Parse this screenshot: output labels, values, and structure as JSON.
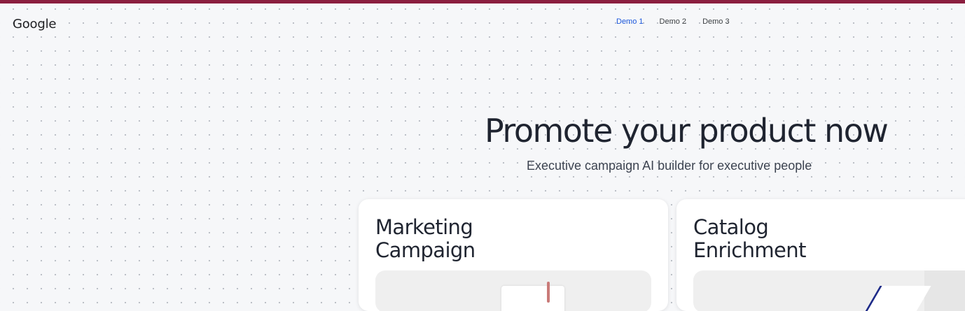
{
  "app": {
    "logo": "Google",
    "accent_color": "#8b1e3f"
  },
  "nav": {
    "items": [
      {
        "label": "Demo 1",
        "active": true
      },
      {
        "label": "Demo 2",
        "active": false
      },
      {
        "label": "Demo 3",
        "active": false
      }
    ],
    "active_color": "#1a56db"
  },
  "hero": {
    "title": "Promote your product now",
    "subtitle": "Executive campaign AI builder for executive people"
  },
  "cards": [
    {
      "title_line1": "Marketing",
      "title_line2": "Campaign"
    },
    {
      "title_line1": "Catalog",
      "title_line2": "Enrichment"
    }
  ]
}
